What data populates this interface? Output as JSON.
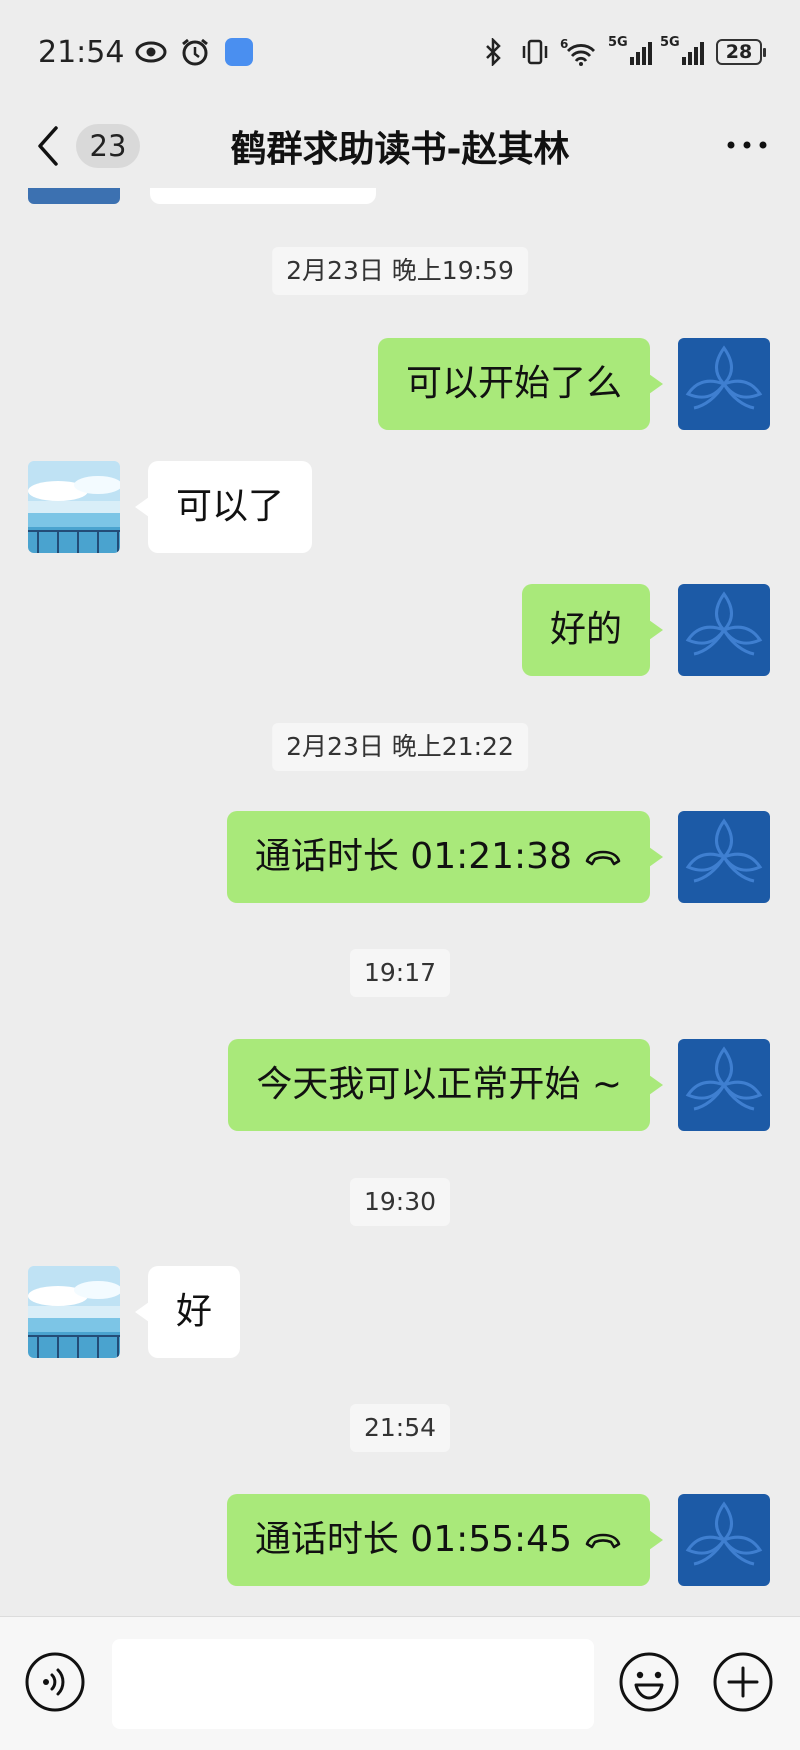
{
  "status_bar": {
    "time": "21:54",
    "battery": "28",
    "left_icons": [
      "eye-icon",
      "alarm-icon",
      "message-app-icon"
    ],
    "right_icons": [
      "bluetooth-icon",
      "vibrate-icon",
      "wifi-icon",
      "signal-5g-icon",
      "signal-5g-icon",
      "battery-icon"
    ],
    "signal_labels": [
      "5G",
      "5G"
    ],
    "wifi_label": "6"
  },
  "header": {
    "unread_count": "23",
    "title": "鹤群求助读书-赵其林",
    "back_icon": "chevron-left-icon",
    "more_icon": "more-dots-icon"
  },
  "messages": [
    {
      "type": "timestamp",
      "text": "2月23日 晚上19:59"
    },
    {
      "type": "sent",
      "text": "可以开始了么"
    },
    {
      "type": "received",
      "text": "可以了"
    },
    {
      "type": "sent",
      "text": "好的"
    },
    {
      "type": "timestamp",
      "text": "2月23日 晚上21:22"
    },
    {
      "type": "sent-call",
      "text": "通话时长 01:21:38",
      "icon": "phone-hangup-icon"
    },
    {
      "type": "timestamp",
      "text": "19:17"
    },
    {
      "type": "sent",
      "text": "今天我可以正常开始 ~"
    },
    {
      "type": "timestamp",
      "text": "19:30"
    },
    {
      "type": "received",
      "text": "好"
    },
    {
      "type": "timestamp",
      "text": "21:54"
    },
    {
      "type": "sent-call",
      "text": "通话时长 01:55:45",
      "icon": "phone-hangup-icon"
    }
  ],
  "input_bar": {
    "voice_icon": "voice-icon",
    "emoji_icon": "emoji-icon",
    "plus_icon": "plus-icon",
    "input_value": ""
  },
  "colors": {
    "background": "#ededed",
    "sent_bubble": "#a9e97a",
    "received_bubble": "#ffffff",
    "my_avatar": "#1c5aa6"
  }
}
